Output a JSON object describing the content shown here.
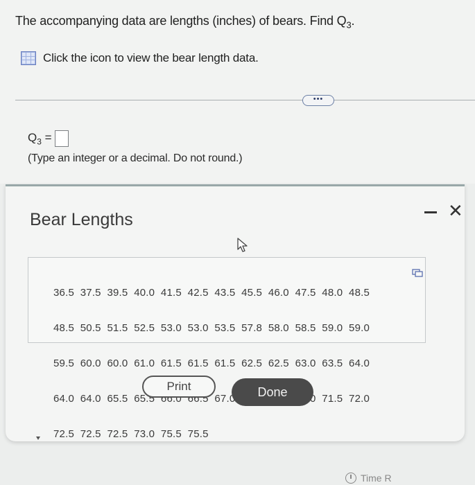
{
  "question": {
    "text_prefix": "The accompanying data are lengths (inches) of bears. Find Q",
    "text_sub": "3",
    "text_suffix": "."
  },
  "data_link": {
    "icon": "table-grid-icon",
    "label": "Click the icon to view the bear length data."
  },
  "more_button": {
    "label": "•••"
  },
  "answer": {
    "label_prefix": "Q",
    "label_sub": "3",
    "label_suffix": " =",
    "value": "",
    "hint": "(Type an integer or a decimal. Do not round.)"
  },
  "modal": {
    "title": "Bear Lengths",
    "minimize_icon": "minimize-icon",
    "close_icon": "close-icon",
    "close_glyph": "✕",
    "data_lines": [
      "36.5  37.5  39.5  40.0  41.5  42.5  43.5  45.5  46.0  47.5  48.0  48.5",
      "48.5  50.5  51.5  52.5  53.0  53.0  53.5  57.8  58.0  58.5  59.0  59.0",
      "59.5  60.0  60.0  61.0  61.5  61.5  61.5  62.5  62.5  63.0  63.5  64.0",
      "64.0  64.0  65.5  65.5  66.0  66.5  67.0  68.5  69.5  70.0  71.5  72.0",
      "72.5  72.5  72.5  73.0  75.5  75.5"
    ],
    "copy_icon": "copy-icon",
    "print_label": "Print",
    "done_label": "Done"
  },
  "footer": {
    "timer_label": "Time R",
    "timer_icon": "clock-icon"
  }
}
